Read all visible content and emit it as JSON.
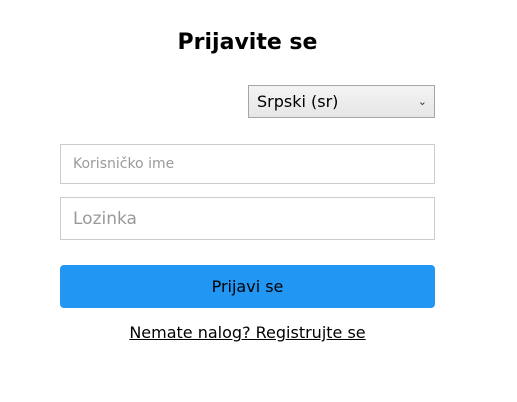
{
  "login": {
    "title": "Prijavite se",
    "language": {
      "selected": "Srpski (sr)",
      "chevron": "chevron-down-icon"
    },
    "username_placeholder": "Korisničko ime",
    "password_placeholder": "Lozinka",
    "submit_label": "Prijavi se",
    "register_link": "Nemate nalog? Registrujte se"
  },
  "colors": {
    "primary_button": "#2196f3",
    "border": "#cccccc",
    "placeholder": "#9a9a9a"
  }
}
